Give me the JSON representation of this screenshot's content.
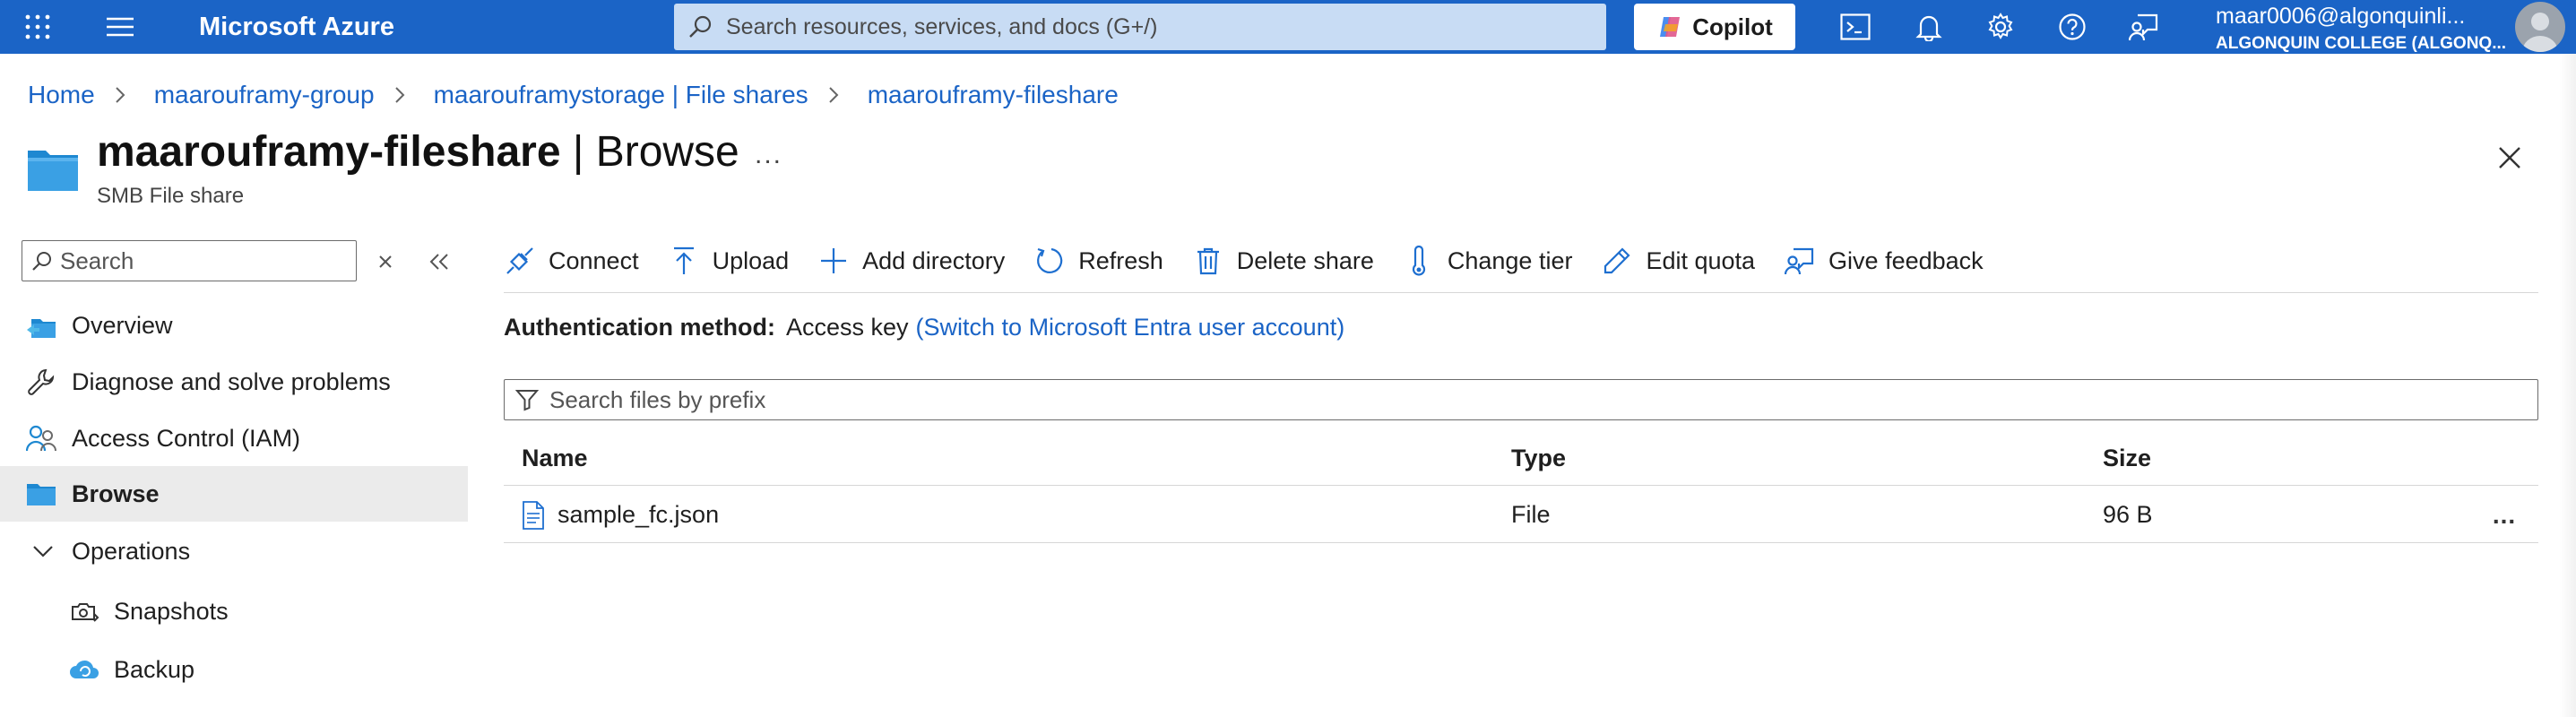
{
  "topbar": {
    "brand": "Microsoft Azure",
    "search_placeholder": "Search resources, services, and docs (G+/)",
    "copilot_label": "Copilot",
    "account_email": "maar0006@algonquinli...",
    "account_org": "ALGONQUIN COLLEGE (ALGONQ..."
  },
  "breadcrumb": [
    "Home",
    "maaroufram​y-group",
    "maarouframystorage | File shares",
    "maarouframy-fileshare"
  ],
  "page": {
    "title_bold": "maarouframy-fileshare",
    "title_rest": " | Browse",
    "more": "...",
    "subtitle": "SMB File share"
  },
  "nav": {
    "search_placeholder": "Search",
    "items": [
      {
        "label": "Overview",
        "icon": "overview-icon"
      },
      {
        "label": "Diagnose and solve problems",
        "icon": "wrench-icon"
      },
      {
        "label": "Access Control (IAM)",
        "icon": "people-icon"
      },
      {
        "label": "Browse",
        "icon": "folder-icon",
        "active": true
      },
      {
        "label": "Operations",
        "icon": "chevron-down-icon"
      },
      {
        "label": "Snapshots",
        "icon": "snapshots-icon"
      },
      {
        "label": "Backup",
        "icon": "backup-cloud-icon"
      }
    ]
  },
  "toolbar": {
    "items": [
      {
        "label": "Connect",
        "icon": "connect-icon"
      },
      {
        "label": "Upload",
        "icon": "upload-icon"
      },
      {
        "label": "Add directory",
        "icon": "plus-icon"
      },
      {
        "label": "Refresh",
        "icon": "refresh-icon"
      },
      {
        "label": "Delete share",
        "icon": "trash-icon"
      },
      {
        "label": "Change tier",
        "icon": "thermometer-icon"
      },
      {
        "label": "Edit quota",
        "icon": "pencil-icon"
      },
      {
        "label": "Give feedback",
        "icon": "feedback-icon"
      }
    ]
  },
  "auth": {
    "label": "Authentication method:",
    "value": "Access key",
    "link": "(Switch to Microsoft Entra user account)"
  },
  "file_search_placeholder": "Search files by prefix",
  "grid": {
    "columns": [
      "Name",
      "Type",
      "Size"
    ],
    "rows": [
      {
        "name": "sample_fc.json",
        "type": "File",
        "size": "96 B",
        "more": "..."
      }
    ]
  },
  "colors": {
    "brand_blue": "#1b64c6",
    "search_bg": "#c8dcf4",
    "active_nav_bg": "#ebebeb"
  }
}
